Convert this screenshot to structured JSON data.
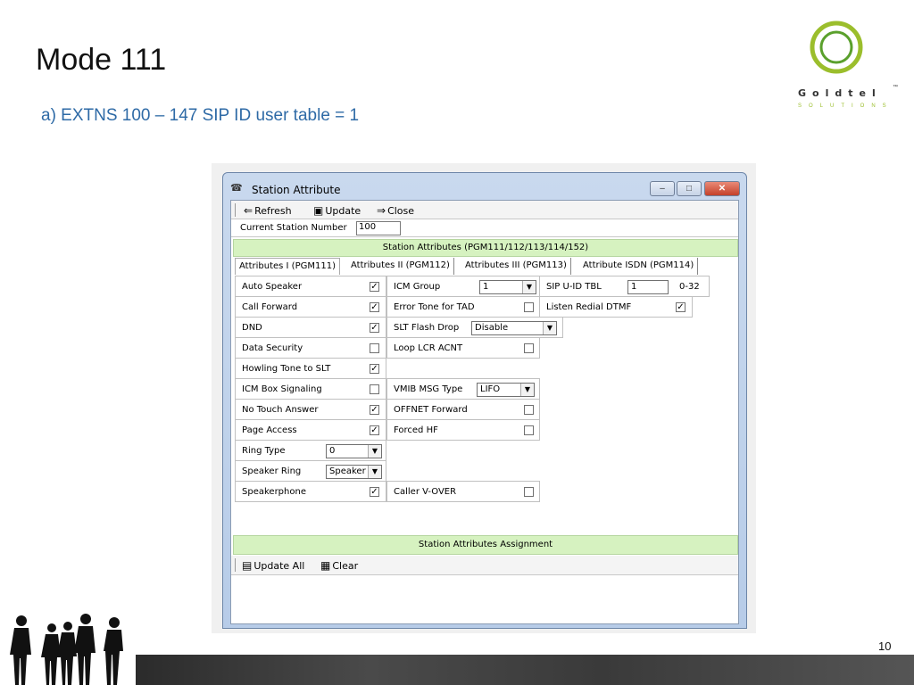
{
  "slide": {
    "title": "Mode 111",
    "subtitle": "a)  EXTNS 100 – 147 SIP ID user table = 1",
    "page_number": "10",
    "logo": {
      "word": "Goldtel",
      "tm": "™",
      "sub": "SOLUTIONS",
      "colors": {
        "ring_outer": "#9bbe2c",
        "ring_inner": "#5aa02c"
      }
    }
  },
  "window": {
    "title": "Station Attribute",
    "controls": {
      "minimize": "–",
      "maximize": "□",
      "close": "✕"
    },
    "toolbar": {
      "refresh": "Refresh",
      "update": "Update",
      "close": "Close"
    },
    "current_station": {
      "label": "Current Station Number",
      "value": "100"
    },
    "attributes_header": "Station Attributes (PGM111/112/113/114/152)",
    "tabs": [
      "Attributes I (PGM111)",
      "Attributes II (PGM112)",
      "Attributes III (PGM113)",
      "Attribute ISDN (PGM114)"
    ],
    "col1": [
      {
        "label": "Auto Speaker",
        "checked": "✓"
      },
      {
        "label": "Call Forward",
        "checked": "✓"
      },
      {
        "label": "DND",
        "checked": "✓"
      },
      {
        "label": "Data Security",
        "checked": ""
      },
      {
        "label": "Howling Tone to SLT",
        "checked": "✓"
      },
      {
        "label": "ICM Box Signaling",
        "checked": ""
      },
      {
        "label": "No Touch Answer",
        "checked": "✓"
      },
      {
        "label": "Page Access",
        "checked": "✓"
      },
      {
        "label": "Ring Type",
        "select": "0"
      },
      {
        "label": "Speaker Ring",
        "select": "Speaker"
      },
      {
        "label": "Speakerphone",
        "checked": "✓"
      }
    ],
    "col2": {
      "icm_group": {
        "label": "ICM Group",
        "value": "1"
      },
      "error_tone": {
        "label": "Error Tone for TAD",
        "checked": ""
      },
      "slt_flash": {
        "label": "SLT Flash Drop",
        "value": "Disable"
      },
      "loop_lcr": {
        "label": "Loop LCR ACNT",
        "checked": ""
      },
      "vmib": {
        "label": "VMIB MSG Type",
        "value": "LIFO"
      },
      "offnet": {
        "label": "OFFNET Forward",
        "checked": ""
      },
      "forced_hf": {
        "label": "Forced HF",
        "checked": ""
      },
      "caller_vover": {
        "label": "Caller V-OVER",
        "checked": ""
      }
    },
    "col3": {
      "sip_uid": {
        "label": "SIP U-ID TBL",
        "value": "1",
        "range": "0-32"
      },
      "listen_redial": {
        "label": "Listen Redial DTMF",
        "checked": "✓"
      }
    },
    "assignment_header": "Station Attributes Assignment",
    "toolbar2": {
      "update_all": "Update All",
      "clear": "Clear"
    }
  }
}
